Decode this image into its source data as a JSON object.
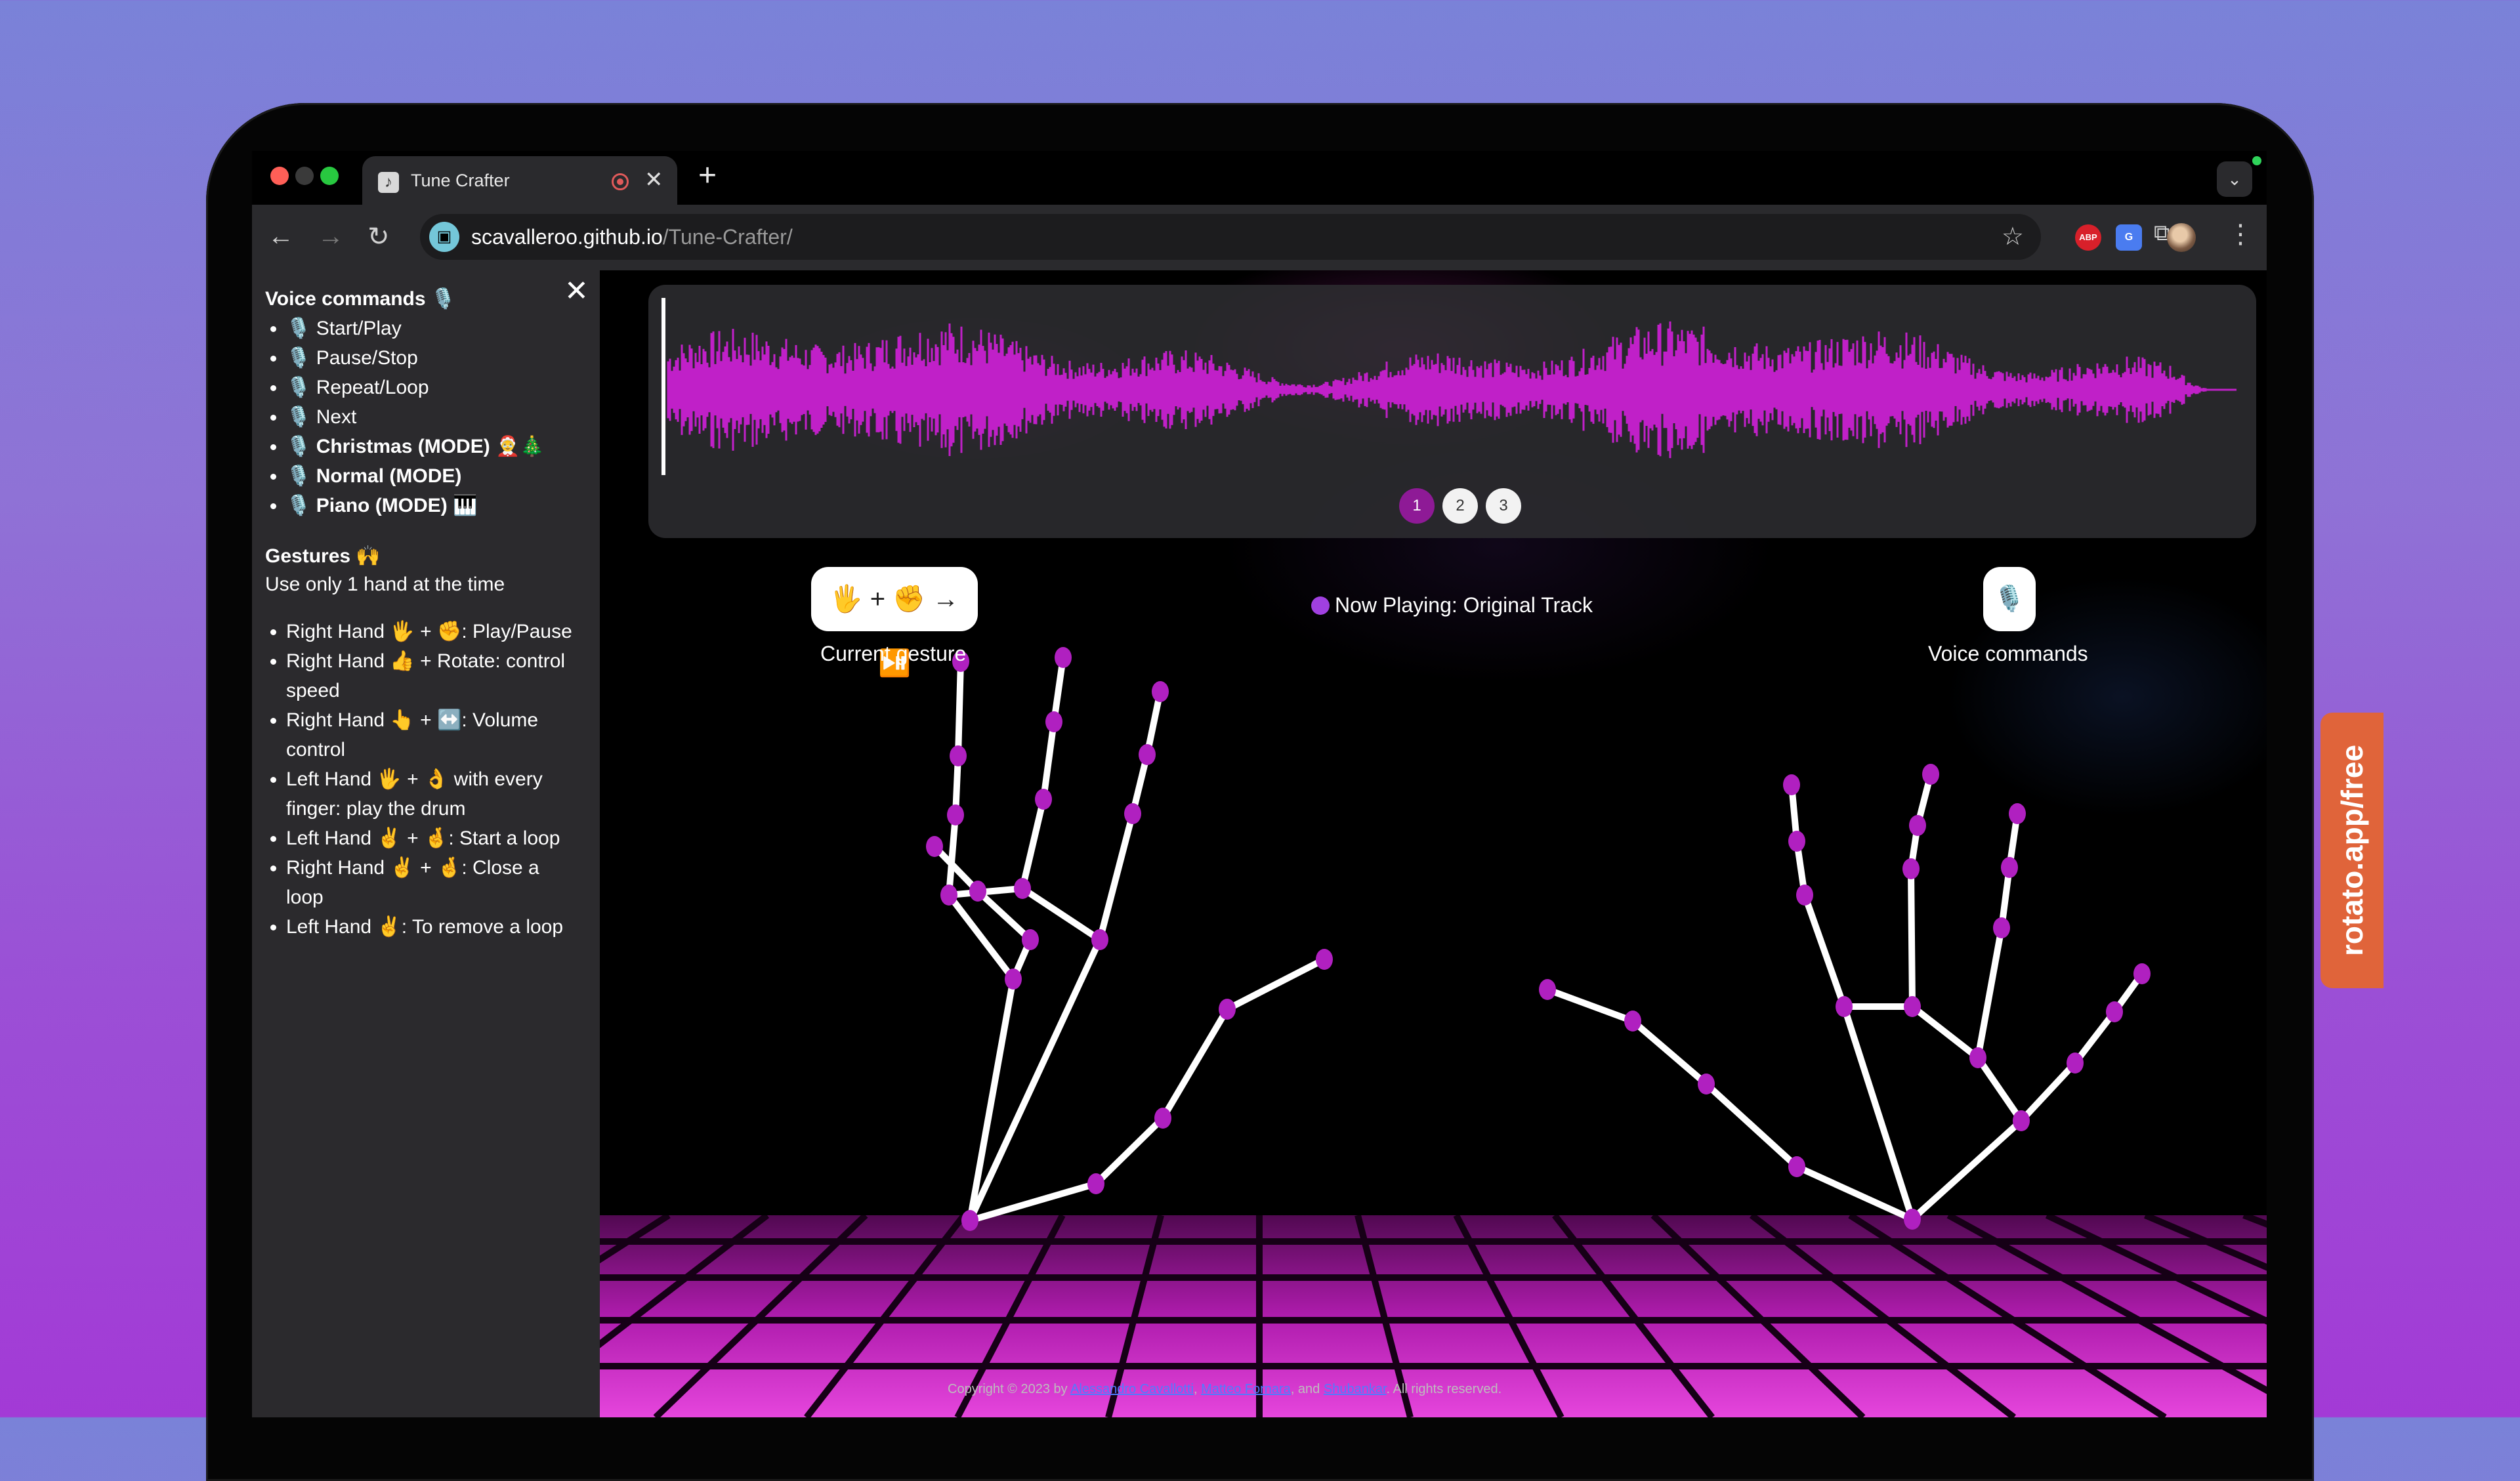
{
  "browser": {
    "tab_title": "Tune Crafter",
    "tab_close": "✕",
    "new_tab": "+",
    "url_host": "scavalleroo.github.io",
    "url_path": "/Tune-Crafter/",
    "traffic_colors": [
      "#ff5f57",
      "#2b2b2b",
      "#28c840"
    ],
    "ext_abp": "ABP",
    "ext_translate": "G"
  },
  "sidebar": {
    "close": "✕",
    "voice_title": "Voice commands 🎙️",
    "voice_items": [
      {
        "label": "🎙️ Start/Play",
        "bold": false
      },
      {
        "label": "🎙️ Pause/Stop",
        "bold": false
      },
      {
        "label": "🎙️ Repeat/Loop",
        "bold": false
      },
      {
        "label": "🎙️ Next",
        "bold": false
      },
      {
        "label": "🎙️ Christmas (MODE) 🤶🎄",
        "bold": true
      },
      {
        "label": "🎙️ Normal (MODE)",
        "bold": true
      },
      {
        "label": "🎙️ Piano (MODE) 🎹",
        "bold": true
      }
    ],
    "gestures_title": "Gestures 🙌",
    "gestures_note": "Use only 1 hand at the time",
    "gesture_items": [
      "Right Hand 🖐️ + ✊: Play/Pause",
      "Right Hand 👍 + Rotate: control speed",
      "Right Hand 👆 + ↔️: Volume control",
      "Left Hand 🖐️ + 👌 with every finger: play the drum",
      "Left Hand ✌️ + 🤞: Start a loop",
      "Right Hand ✌️ + 🤞: Close a loop",
      "Left Hand ✌️: To remove a loop"
    ]
  },
  "player": {
    "pages": [
      "1",
      "2",
      "3"
    ],
    "active_page": 0,
    "wave_color": "#c020c8",
    "current_gesture_icons": "🖐️ + ✊ → ⏯️",
    "current_gesture_label": "Current gesture",
    "voice_icon": "🎙️",
    "voice_label": "Voice commands",
    "now_playing": "Now Playing: Original Track"
  },
  "footer": {
    "prefix": "Copyright © 2023 by ",
    "author1": "Alessandro Cavallotti",
    "sep1": ", ",
    "author2": "Matteo Fornara",
    "sep2": ", and ",
    "author3": "Shubankar",
    "suffix": ". All rights reserved."
  },
  "badge": {
    "text": "rotato.app/free",
    "color": "#e0643a"
  }
}
